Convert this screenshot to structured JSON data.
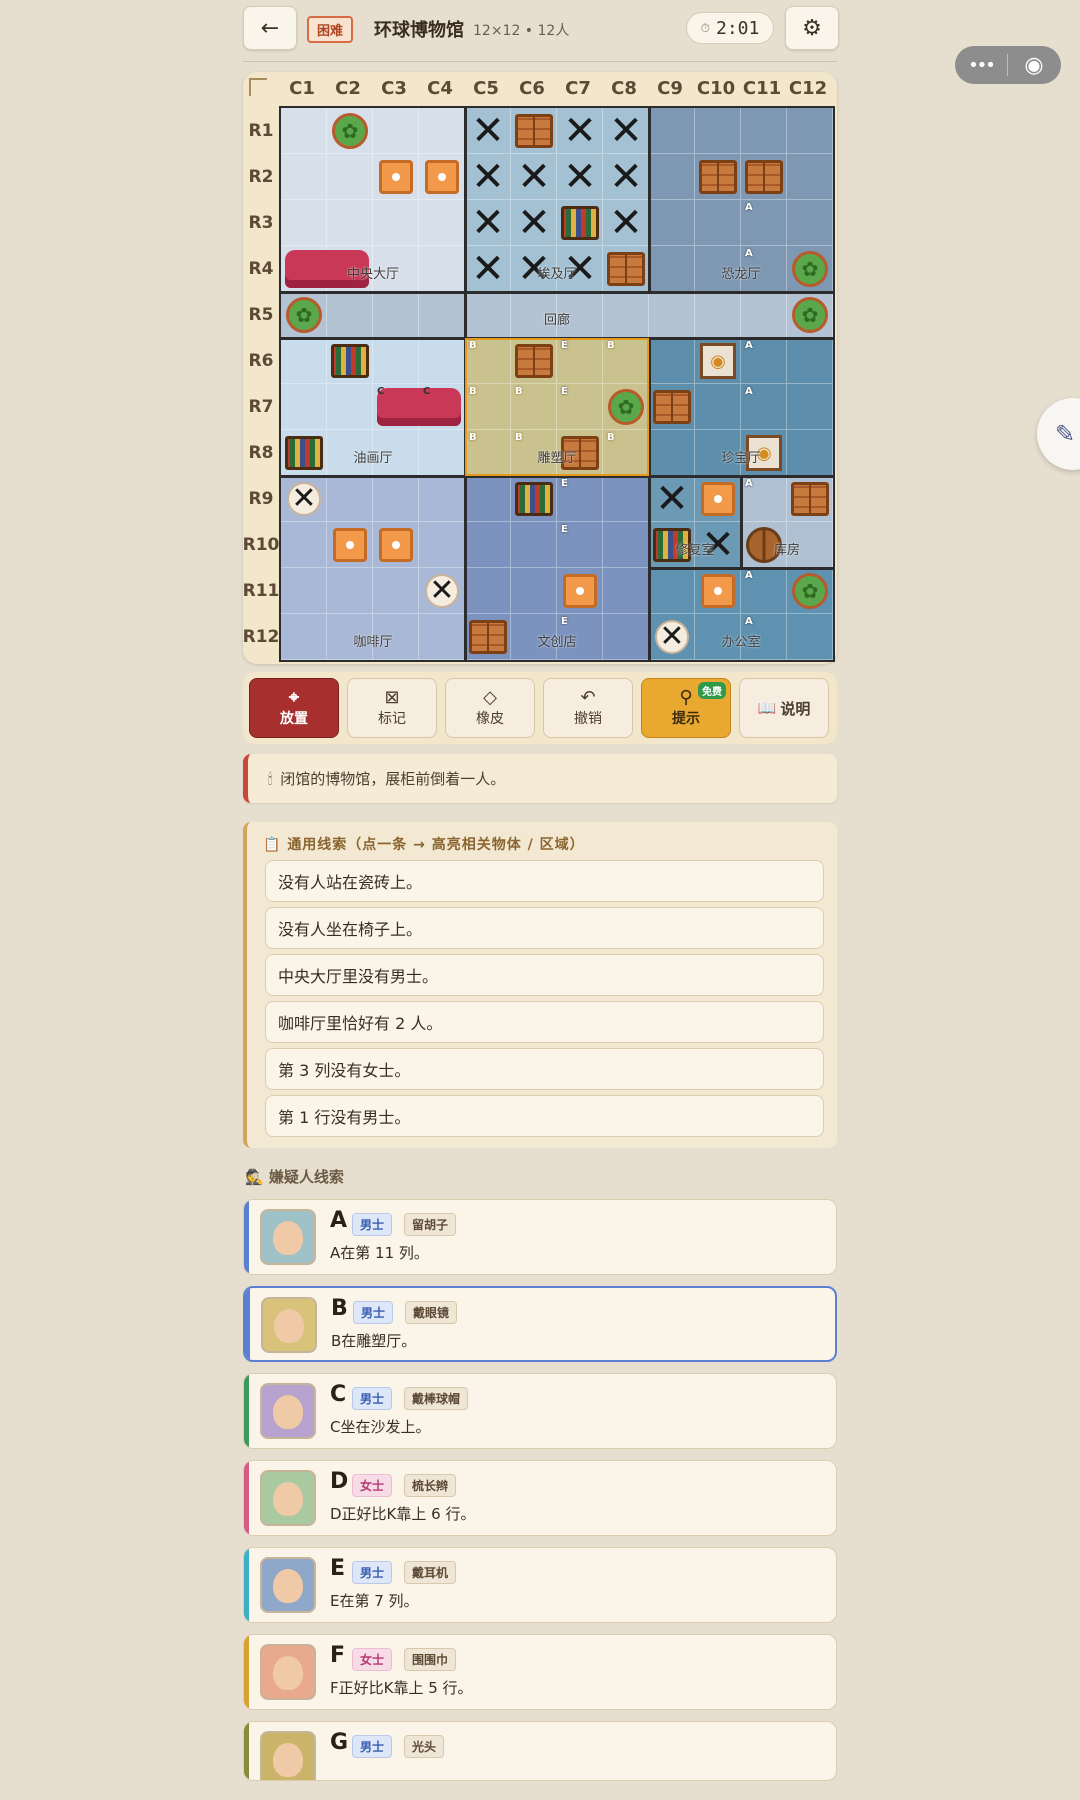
{
  "topbar": {
    "back_icon": "arrow-left-icon",
    "difficulty": "困难",
    "title": "环球博物馆",
    "subtitle": "12×12 • 12人",
    "timer": "2:01",
    "settings_icon": "gear-icon"
  },
  "capsule": {
    "more_icon": "more-dots-icon",
    "close_icon": "target-icon"
  },
  "board": {
    "columns": [
      "C1",
      "C2",
      "C3",
      "C4",
      "C5",
      "C6",
      "C7",
      "C8",
      "C9",
      "C10",
      "C11",
      "C12"
    ],
    "rows": [
      "R1",
      "R2",
      "R3",
      "R4",
      "R5",
      "R6",
      "R7",
      "R8",
      "R9",
      "R10",
      "R11",
      "R12"
    ],
    "region_labels": {
      "central": "中央大厅",
      "egypt": "埃及厅",
      "dino": "恐龙厅",
      "corridor": "回廊",
      "oil": "油画厅",
      "sculpture": "雕塑厅",
      "treasure": "珍宝厅",
      "repair": "修复室",
      "storage": "库房",
      "cafe": "咖啡厅",
      "shop": "文创店",
      "office": "办公室"
    },
    "tag_letters": {
      "a": "A",
      "b": "B",
      "c": "C",
      "e": "E"
    },
    "colors": {
      "central": "#d7e0ea",
      "egypt": "#a3c1d3",
      "dino": "#7e98b4",
      "corridor": "#b4c3d3",
      "oil": "#c8dceb",
      "sculpture": "#c9c18e",
      "treasure": "#5d8fad",
      "cafe": "#a9b8d6",
      "shop": "#7c93bf",
      "repair": "#6c99b4",
      "storage": "#aec0d2",
      "office": "#5e92b0",
      "highlight": "#e39a1e"
    }
  },
  "toolbar": {
    "place": {
      "label": "放置",
      "icon": "map-pin-icon"
    },
    "mark": {
      "label": "标记",
      "icon": "x-box-icon"
    },
    "erase": {
      "label": "橡皮",
      "icon": "eraser-icon"
    },
    "undo": {
      "label": "撤销",
      "icon": "undo-icon"
    },
    "hint": {
      "label": "提示",
      "icon": "search-icon",
      "badge": "免费"
    },
    "help": {
      "label": "说明",
      "icon": "book-icon"
    }
  },
  "story": {
    "icon": "candle-icon",
    "text": "闭馆的博物馆，展柜前倒着一人。"
  },
  "clues": {
    "title": "通用线索（点一条 → 高亮相关物体 / 区域）",
    "icon": "clipboard-icon",
    "items": [
      "没有人站在瓷砖上。",
      "没有人坐在椅子上。",
      "中央大厅里没有男士。",
      "咖啡厅里恰好有 2 人。",
      "第 3 列没有女士。",
      "第 1 行没有男士。"
    ]
  },
  "suspects": {
    "title": "嫌疑人线索",
    "icon": "detective-icon",
    "items": [
      {
        "letter": "A",
        "gender": "男士",
        "trait": "留胡子",
        "desc": "A在第 11 列。",
        "color": "#5b7fd1"
      },
      {
        "letter": "B",
        "gender": "男士",
        "trait": "戴眼镜",
        "desc": "B在雕塑厅。",
        "color": "#5b7fd1"
      },
      {
        "letter": "C",
        "gender": "男士",
        "trait": "戴棒球帽",
        "desc": "C坐在沙发上。",
        "color": "#3f9a5a"
      },
      {
        "letter": "D",
        "gender": "女士",
        "trait": "梳长辫",
        "desc": "D正好比K靠上 6 行。",
        "color": "#d65b86"
      },
      {
        "letter": "E",
        "gender": "男士",
        "trait": "戴耳机",
        "desc": "E在第 7 列。",
        "color": "#3bb0c4"
      },
      {
        "letter": "F",
        "gender": "女士",
        "trait": "围围巾",
        "desc": "F正好比K靠上 5 行。",
        "color": "#d4a233"
      },
      {
        "letter": "G",
        "gender": "男士",
        "trait": "光头",
        "desc": "",
        "color": "#8a8a3a"
      }
    ]
  }
}
